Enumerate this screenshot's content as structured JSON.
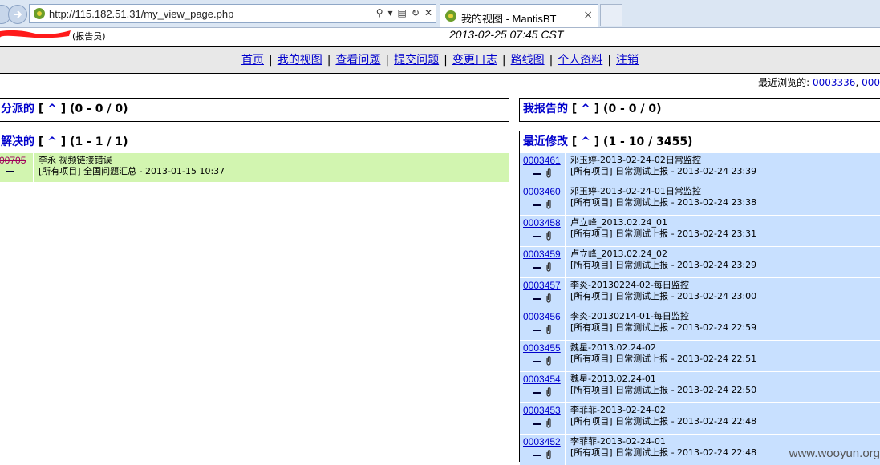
{
  "browser": {
    "url": "http://115.182.51.31/my_view_page.php",
    "tab_title": "我的视图 - MantisBT",
    "tab_close": "×",
    "addr_close": "✕"
  },
  "header": {
    "role": "(报告员)",
    "datetime": "2013-02-25 07:45 CST"
  },
  "menu": [
    "首页",
    "我的视图",
    "查看问题",
    "提交问题",
    "变更日志",
    "路线图",
    "个人资料",
    "注销"
  ],
  "recent": {
    "label": "最近浏览的: ",
    "items": [
      "0003336",
      "000"
    ]
  },
  "boxes": {
    "assigned": {
      "title": "分派的",
      "caret": "^",
      "range": "(0 - 0 / 0)"
    },
    "reported": {
      "title": "我报告的",
      "caret": "^",
      "range": "(0 - 0 / 0)"
    },
    "resolved": {
      "title": "解决的",
      "caret": "^",
      "range": "(1 - 1 / 1)",
      "rows": [
        {
          "id": "00705",
          "summary": "李永 视频链接错误",
          "meta": "[所有项目] 全国问题汇总 - 2013-01-15 10:37"
        }
      ]
    },
    "recent_mod": {
      "title": "最近修改",
      "caret": "^",
      "range": "(1 - 10 / 3455)",
      "rows": [
        {
          "id": "0003461",
          "summary": "邓玉婷-2013-02-24-02日常监控",
          "meta": "[所有项目] 日常测试上报 - 2013-02-24 23:39"
        },
        {
          "id": "0003460",
          "summary": "邓玉婷-2013-02-24-01日常监控",
          "meta": "[所有项目] 日常测试上报 - 2013-02-24 23:38"
        },
        {
          "id": "0003458",
          "summary": "卢立峰_2013.02.24_01",
          "meta": "[所有项目] 日常测试上报 - 2013-02-24 23:31"
        },
        {
          "id": "0003459",
          "summary": "卢立峰_2013.02.24_02",
          "meta": "[所有项目] 日常测试上报 - 2013-02-24 23:29"
        },
        {
          "id": "0003457",
          "summary": "李炎-20130224-02-每日监控",
          "meta": "[所有项目] 日常测试上报 - 2013-02-24 23:00"
        },
        {
          "id": "0003456",
          "summary": "李炎-20130214-01-每日监控",
          "meta": "[所有项目] 日常测试上报 - 2013-02-24 22:59"
        },
        {
          "id": "0003455",
          "summary": "魏星-2013.02.24-02",
          "meta": "[所有项目] 日常测试上报 - 2013-02-24 22:51"
        },
        {
          "id": "0003454",
          "summary": "魏星-2013.02.24-01",
          "meta": "[所有项目] 日常测试上报 - 2013-02-24 22:50"
        },
        {
          "id": "0003453",
          "summary": "李菲菲-2013-02-24-02",
          "meta": "[所有项目] 日常测试上报 - 2013-02-24 22:48"
        },
        {
          "id": "0003452",
          "summary": "李菲菲-2013-02-24-01",
          "meta": "[所有项目] 日常测试上报 - 2013-02-24 22:48"
        }
      ]
    }
  },
  "watermark": "www.wooyun.org"
}
